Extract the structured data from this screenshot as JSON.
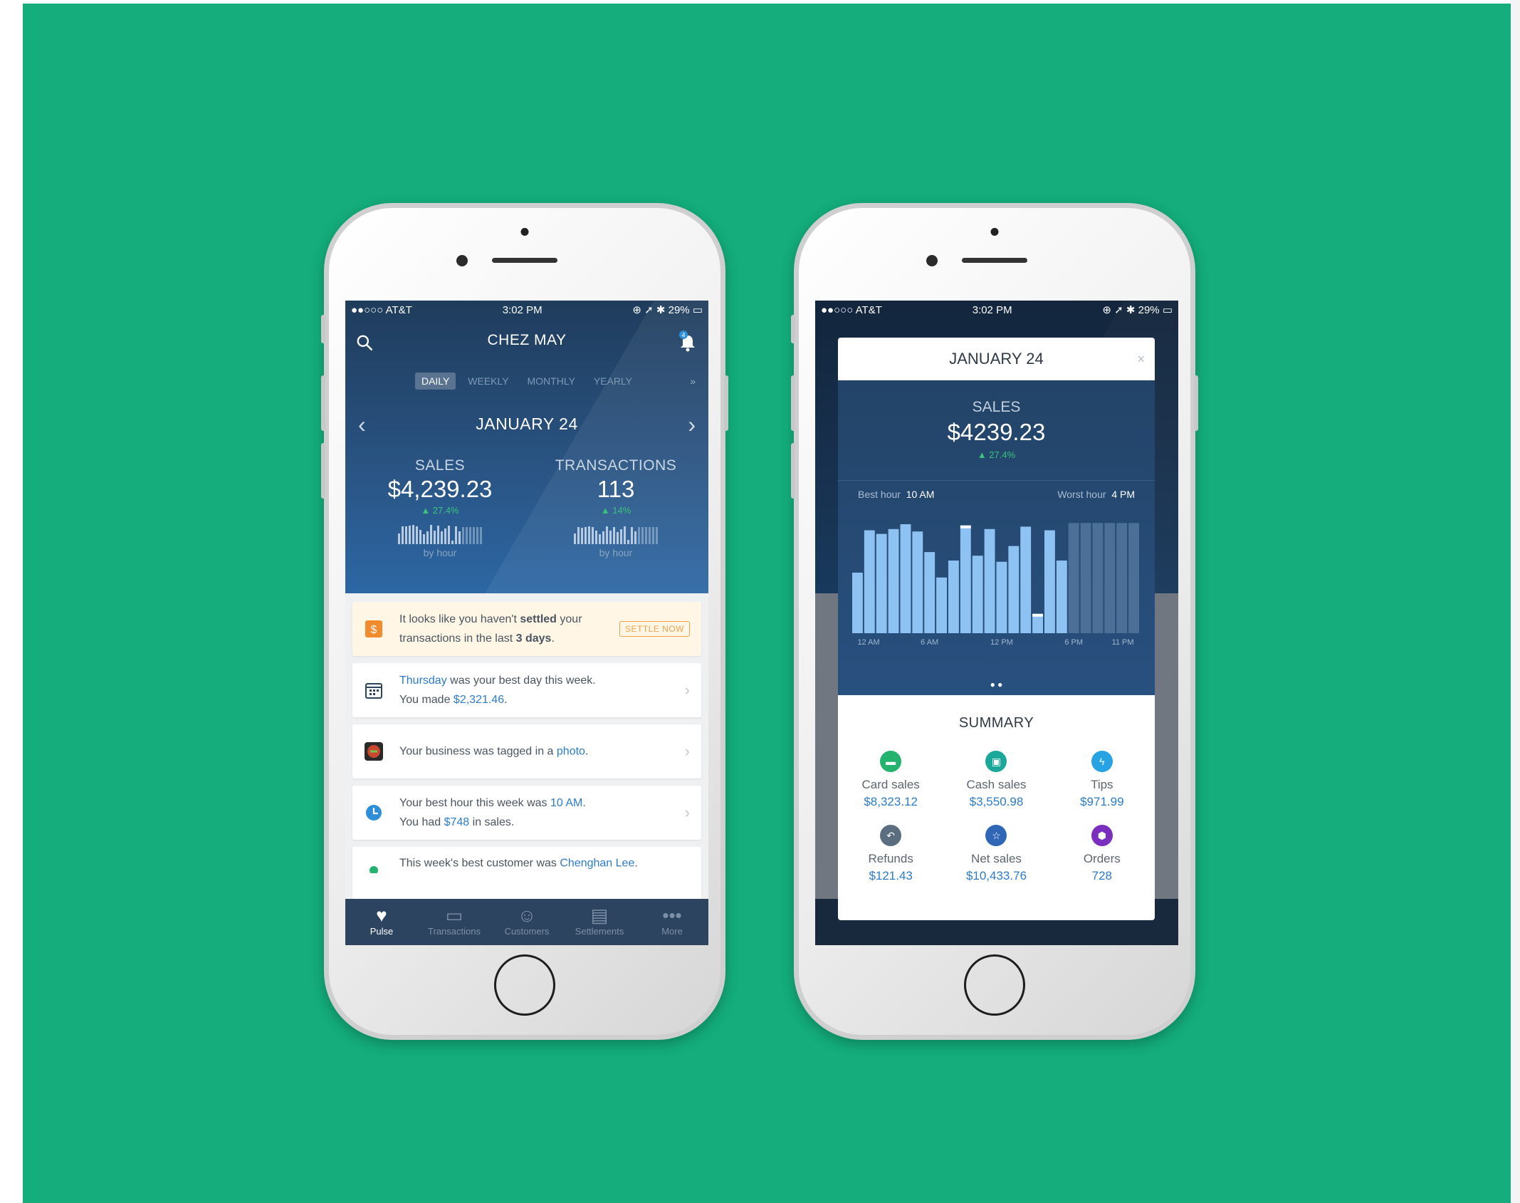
{
  "background": {
    "color": "#14ad7b"
  },
  "status_bar": {
    "carrier": "●●○○○ AT&T",
    "time": "3:02 PM",
    "battery": "29%"
  },
  "left_screen": {
    "title": "CHEZ MAY",
    "notification_count": "4",
    "period_tabs": [
      "DAILY",
      "WEEKLY",
      "MONTHLY",
      "YEARLY"
    ],
    "active_tab": "DAILY",
    "date": "JANUARY 24",
    "sales": {
      "label": "SALES",
      "value": "$4,239.23",
      "change": "▲ 27.4%",
      "caption": "by hour"
    },
    "transactions": {
      "label": "TRANSACTIONS",
      "value": "113",
      "change": "▲ 14%",
      "caption": "by hour"
    },
    "cards": [
      {
        "pre": "It looks like you haven't ",
        "bold1": "settled",
        "mid": " your",
        "line2": "transactions in the last ",
        "bold2": "3 days",
        "end": ".",
        "action": "SETTLE NOW"
      },
      {
        "link": "Thursday",
        "text": " was your best day this week.",
        "line2_pre": "You made ",
        "line2_link": "$2,321.46",
        "line2_end": "."
      },
      {
        "text": "Your business was tagged in a ",
        "link": "photo",
        "end": "."
      },
      {
        "text": "Your best hour this week was ",
        "link": "10 AM",
        "end": ".",
        "line2_pre": "You had ",
        "line2_link": "$748",
        "line2_end": " in sales."
      },
      {
        "text": "This week's best customer was ",
        "link": "Chenghan Lee",
        "end": "."
      }
    ],
    "tabbar": [
      "Pulse",
      "Transactions",
      "Customers",
      "Settlements",
      "More"
    ]
  },
  "modal": {
    "title": "JANUARY 24",
    "close": "×",
    "sales_label": "SALES",
    "sales_value": "$4239.23",
    "sales_change": "▲ 27.4%",
    "best_hour_label": "Best hour",
    "best_hour": "10 AM",
    "worst_hour_label": "Worst hour",
    "worst_hour": "4 PM",
    "pager": "● ●",
    "summary_title": "SUMMARY",
    "summary": [
      {
        "label": "Card sales",
        "value": "$8,323.12",
        "icon": "card-icon",
        "color": "#23b36f"
      },
      {
        "label": "Cash sales",
        "value": "$3,550.98",
        "icon": "cash-icon",
        "color": "#1ba89a"
      },
      {
        "label": "Tips",
        "value": "$971.99",
        "icon": "lightning-icon",
        "color": "#27a3e3"
      },
      {
        "label": "Refunds",
        "value": "$121.43",
        "icon": "refund-icon",
        "color": "#5b6e80"
      },
      {
        "label": "Net sales",
        "value": "$10,433.76",
        "icon": "star-icon",
        "color": "#2f66b5"
      },
      {
        "label": "Orders",
        "value": "728",
        "icon": "box-icon",
        "color": "#7b2fbf"
      }
    ]
  },
  "chart_data": {
    "type": "bar",
    "title": "",
    "xlabel": "",
    "ylabel": "",
    "x_tick_labels": [
      "12 AM",
      "6 AM",
      "12 PM",
      "6 PM",
      "11 PM"
    ],
    "categories": [
      "12 AM",
      "1 AM",
      "2 AM",
      "3 AM",
      "4 AM",
      "5 AM",
      "6 AM",
      "7 AM",
      "8 AM",
      "9 AM",
      "10 AM",
      "11 AM",
      "12 PM",
      "1 PM",
      "2 PM",
      "3 PM",
      "4 PM",
      "5 PM",
      "6 PM",
      "7 PM",
      "8 PM",
      "9 PM",
      "10 PM",
      "11 PM"
    ],
    "values": [
      50,
      85,
      82,
      86,
      90,
      84,
      67,
      46,
      60,
      89,
      64,
      86,
      59,
      72,
      88,
      16,
      85,
      60,
      91,
      91,
      91,
      91,
      91,
      91
    ],
    "highlighted": [
      false,
      false,
      false,
      false,
      false,
      false,
      false,
      false,
      false,
      true,
      false,
      false,
      false,
      false,
      false,
      true,
      false,
      false,
      false,
      false,
      false,
      false,
      false,
      false
    ],
    "future": [
      false,
      false,
      false,
      false,
      false,
      false,
      false,
      false,
      false,
      false,
      false,
      false,
      false,
      false,
      false,
      false,
      false,
      false,
      true,
      true,
      true,
      true,
      true,
      true
    ],
    "ylim": [
      0,
      100
    ]
  }
}
